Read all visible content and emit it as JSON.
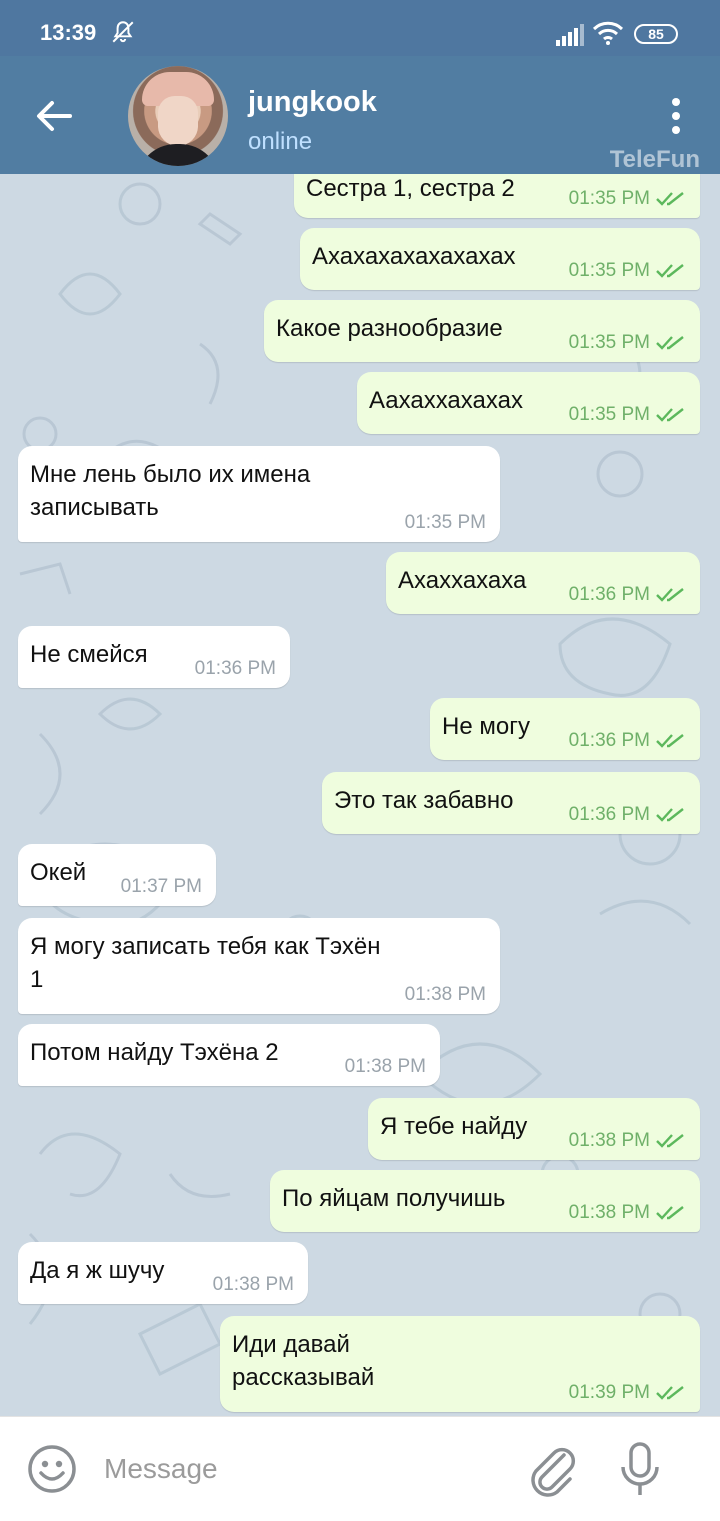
{
  "status_bar": {
    "time": "13:39",
    "battery": "85"
  },
  "header": {
    "name": "jungkook",
    "status": "online",
    "watermark": "TeleFun"
  },
  "messages": [
    {
      "dir": "out",
      "text": "Сестра 1, сестра 2",
      "time": "01:35 PM"
    },
    {
      "dir": "out",
      "text": "Ахахахахахахахах",
      "time": "01:35 PM"
    },
    {
      "dir": "out",
      "text": "Какое разнообразие",
      "time": "01:35 PM"
    },
    {
      "dir": "out",
      "text": "Аахаххахахах",
      "time": "01:35 PM"
    },
    {
      "dir": "in",
      "text": "Мне лень было их имена\nзаписывать",
      "time": "01:35 PM"
    },
    {
      "dir": "out",
      "text": "Ахаххахаха",
      "time": "01:36 PM"
    },
    {
      "dir": "in",
      "text": "Не смейся",
      "time": "01:36 PM"
    },
    {
      "dir": "out",
      "text": "Не могу",
      "time": "01:36 PM"
    },
    {
      "dir": "out",
      "text": "Это так забавно",
      "time": "01:36 PM"
    },
    {
      "dir": "in",
      "text": "Окей",
      "time": "01:37 PM"
    },
    {
      "dir": "in",
      "text": "Я могу записать тебя как Тэхён\n1",
      "time": "01:38 PM"
    },
    {
      "dir": "in",
      "text": "Потом найду Тэхёна 2",
      "time": "01:38 PM"
    },
    {
      "dir": "out",
      "text": "Я тебе найду",
      "time": "01:38 PM"
    },
    {
      "dir": "out",
      "text": "По яйцам получишь",
      "time": "01:38 PM"
    },
    {
      "dir": "in",
      "text": "Да я ж шучу",
      "time": "01:38 PM"
    },
    {
      "dir": "out",
      "text": "Иди давай\nрассказывай",
      "time": "01:39 PM"
    }
  ],
  "input": {
    "placeholder": "Message"
  },
  "colors": {
    "header": "#517da2",
    "outgoing_bubble": "#effdde",
    "incoming_bubble": "#ffffff",
    "read_ticks": "#5cb85c"
  },
  "icons": [
    "bell-off-icon",
    "signal-icon",
    "wifi-icon",
    "battery-icon",
    "back-arrow-icon",
    "more-vert-icon",
    "double-check-icon",
    "emoji-icon",
    "attach-icon",
    "mic-icon"
  ]
}
